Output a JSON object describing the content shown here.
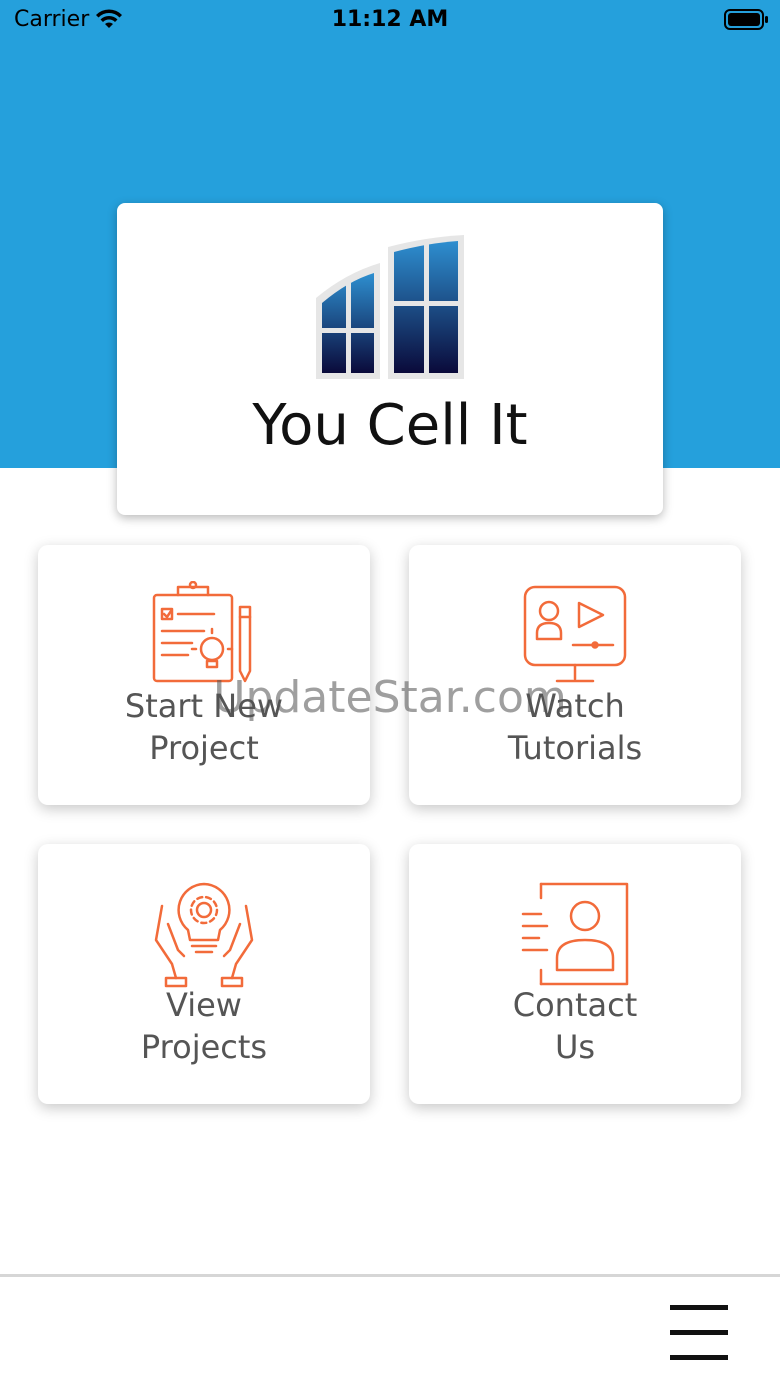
{
  "status_bar": {
    "carrier": "Carrier",
    "time": "11:12 AM"
  },
  "app": {
    "title": "You Cell It"
  },
  "tiles": [
    {
      "line1": "Start New",
      "line2": "Project",
      "icon": "clipboard-idea-icon"
    },
    {
      "line1": "Watch",
      "line2": "Tutorials",
      "icon": "video-tutorial-icon"
    },
    {
      "line1": "View",
      "line2": "Projects",
      "icon": "hands-lightbulb-gear-icon"
    },
    {
      "line1": "Contact",
      "line2": "Us",
      "icon": "contact-card-icon"
    }
  ],
  "watermark": "UpdateStar.com",
  "colors": {
    "hero": "#25a0dc",
    "accent": "#f26b3a",
    "tile_text": "#555555"
  }
}
